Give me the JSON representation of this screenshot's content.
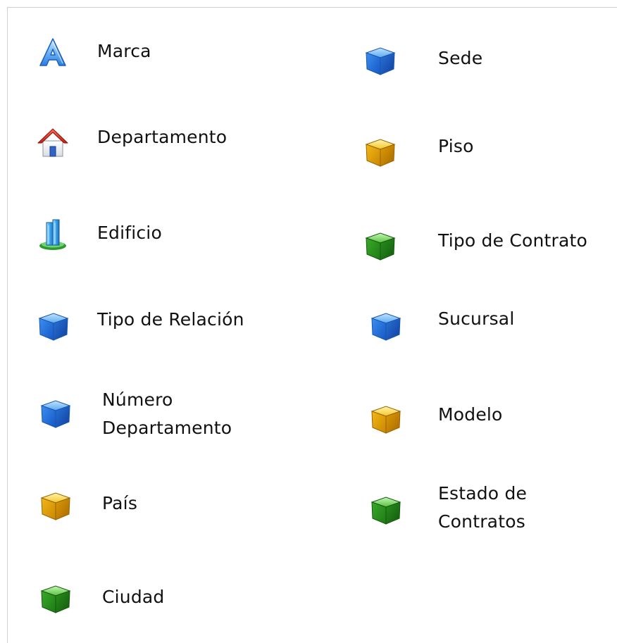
{
  "left_column": [
    {
      "label": "Marca",
      "icon": "letter-a-icon",
      "color": "#3a86e8"
    },
    {
      "label": "Departamento",
      "icon": "house-icon",
      "color": "#e23a2a"
    },
    {
      "label": "Edificio",
      "icon": "building-icon",
      "color": "#3aa6e8"
    },
    {
      "label": "Tipo de Relación",
      "icon": "cube-blue-icon",
      "color": "#2f7de6"
    },
    {
      "label": "Número Departamento",
      "label_lines": [
        "Número",
        "Departamento"
      ],
      "icon": "cube-blue-icon",
      "color": "#2f7de6"
    },
    {
      "label": "País",
      "icon": "cube-yellow-icon",
      "color": "#e0a800"
    },
    {
      "label": "Ciudad",
      "icon": "cube-green-icon",
      "color": "#29a329"
    }
  ],
  "right_column": [
    {
      "label": "Sede",
      "icon": "cube-blue-icon",
      "color": "#2f7de6"
    },
    {
      "label": "Piso",
      "icon": "cube-yellow-icon",
      "color": "#e0a800"
    },
    {
      "label": "Tipo de Contrato",
      "icon": "cube-green-icon",
      "color": "#29a329"
    },
    {
      "label": "Sucursal",
      "icon": "cube-blue-icon",
      "color": "#2f7de6"
    },
    {
      "label": "Modelo",
      "icon": "cube-yellow-icon",
      "color": "#e0a800"
    },
    {
      "label": "Estado de Contratos",
      "label_lines": [
        "Estado de",
        "Contratos"
      ],
      "icon": "cube-green-icon",
      "color": "#29a329"
    }
  ]
}
